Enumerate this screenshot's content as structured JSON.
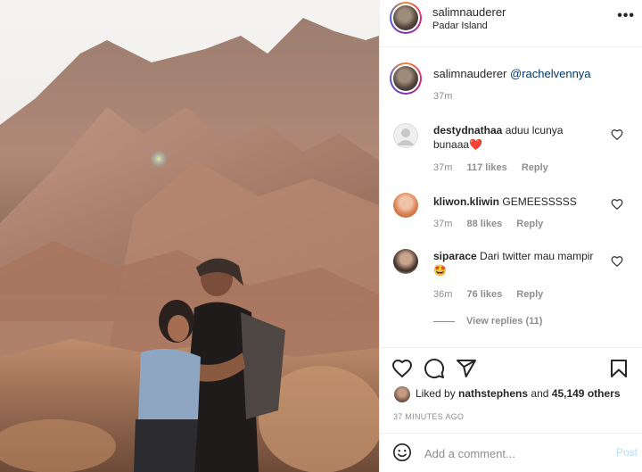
{
  "post": {
    "username": "salimnauderer",
    "location": "Padar Island",
    "more_label": "•••"
  },
  "caption": {
    "username": "salimnauderer",
    "mention": "@rachelvennya",
    "time": "37m"
  },
  "comments": [
    {
      "username": "destydnathaa",
      "text": "aduu lcunya bunaaa",
      "emoji": "❤️",
      "time": "37m",
      "likes": "117 likes",
      "reply": "Reply"
    },
    {
      "username": "kliwon.kliwin",
      "text": "GEMEESSSSS",
      "emoji": "",
      "time": "37m",
      "likes": "88 likes",
      "reply": "Reply"
    },
    {
      "username": "siparace",
      "text": "Dari twitter mau mampir",
      "emoji": "🤩",
      "time": "36m",
      "likes": "76 likes",
      "reply": "Reply"
    }
  ],
  "view_replies": "View replies (11)",
  "likes": {
    "prefix": "Liked by",
    "user": "nathstephens",
    "joiner": "and",
    "others": "45,149 others"
  },
  "time_ago": "37 MINUTES AGO",
  "composer": {
    "placeholder": "Add a comment...",
    "post_label": "Post"
  },
  "icons": [
    "heart-icon",
    "comment-icon",
    "share-icon",
    "bookmark-icon",
    "emoji-icon",
    "more-icon"
  ]
}
